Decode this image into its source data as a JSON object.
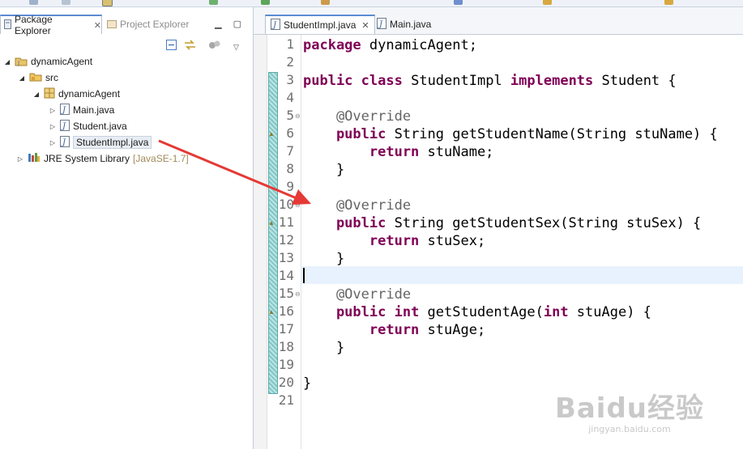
{
  "package_explorer": {
    "tab_active": "Package Explorer",
    "tab_inactive": "Project Explorer",
    "tree": [
      {
        "label": "dynamicAgent"
      },
      {
        "label": "src"
      },
      {
        "label": "dynamicAgent"
      },
      {
        "label": "Main.java"
      },
      {
        "label": "Student.java"
      },
      {
        "label": "StudentImpl.java"
      },
      {
        "label": "JRE System Library",
        "extra": "[JavaSE-1.7]"
      }
    ]
  },
  "editor": {
    "tabs": [
      {
        "label": "StudentImpl.java"
      },
      {
        "label": "Main.java"
      }
    ],
    "line_numbers": [
      "1",
      "2",
      "3",
      "4",
      "5",
      "6",
      "7",
      "8",
      "9",
      "10",
      "11",
      "12",
      "13",
      "14",
      "15",
      "16",
      "17",
      "18",
      "19",
      "20",
      "21"
    ],
    "code": {
      "l1_kw": "package",
      "l1_rest": " dynamicAgent;",
      "l3_kw1": "public",
      "l3_kw2": "class",
      "l3_name": " StudentImpl ",
      "l3_kw3": "implements",
      "l3_rest": " Student {",
      "l5": "    @Override",
      "l6_kw": "    public",
      "l6_rest": " String getStudentName(String stuName) {",
      "l7_kw": "        return",
      "l7_rest": " stuName;",
      "l8": "    }",
      "l10": "    @Override",
      "l11_kw": "    public",
      "l11_rest": " String getStudentSex(String stuSex) {",
      "l12_kw": "        return",
      "l12_rest": " stuSex;",
      "l13": "    }",
      "l15": "    @Override",
      "l16_kw": "    public",
      "l16_kw2": " int",
      "l16_mid": " getStudentAge(",
      "l16_kw3": "int",
      "l16_rest": " stuAge) {",
      "l17_kw": "        return",
      "l17_rest": " stuAge;",
      "l18": "    }",
      "l20": "}"
    }
  },
  "watermark": {
    "brand": "Baidu经验",
    "url": "jingyan.baidu.com"
  },
  "colors": {
    "keyword": "#7f0055",
    "annotation": "#646464",
    "arrow": "#e53935",
    "current_line": "#e8f2fe"
  }
}
